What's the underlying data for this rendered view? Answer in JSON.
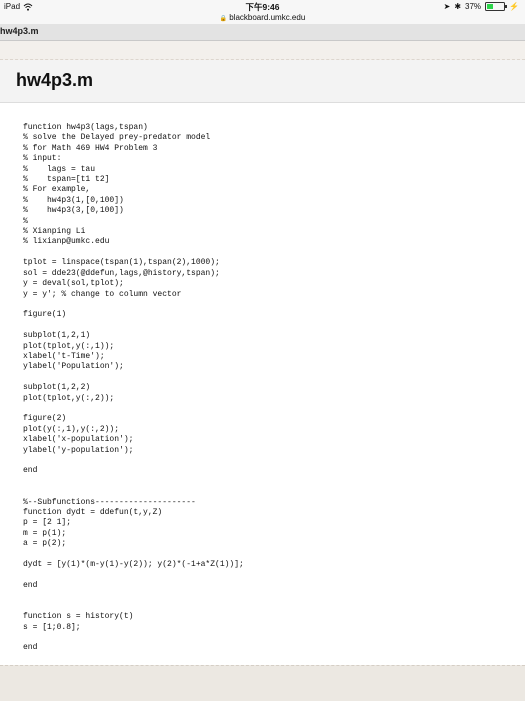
{
  "status_bar": {
    "device": "iPad",
    "time": "下午9:46",
    "battery": "37%",
    "battery_level": 0.37
  },
  "browser": {
    "url": "blackboard.umkc.edu",
    "tab_title": "hw4p3.m"
  },
  "page": {
    "title": "hw4p3.m",
    "code": "function hw4p3(lags,tspan)\n% solve the Delayed prey-predator model\n% for Math 469 HW4 Problem 3\n% input:\n%    lags = tau\n%    tspan=[t1 t2]\n% For example,\n%    hw4p3(1,[0,100])\n%    hw4p3(3,[0,100])\n%\n% Xianping Li\n% lixianp@umkc.edu\n\ntplot = linspace(tspan(1),tspan(2),1000);\nsol = dde23(@ddefun,lags,@history,tspan);\ny = deval(sol,tplot);\ny = y'; % change to column vector\n\nfigure(1)\n\nsubplot(1,2,1)\nplot(tplot,y(:,1));\nxlabel('t-Time');\nylabel('Population');\n\nsubplot(1,2,2)\nplot(tplot,y(:,2));\n\nfigure(2)\nplot(y(:,1),y(:,2));\nxlabel('x-population');\nylabel('y-population');\n\nend\n\n\n%--Subfunctions---------------------\nfunction dydt = ddefun(t,y,Z)\np = [2 1];\nm = p(1);\na = p(2);\n\ndydt = [y(1)*(m-y(1)-y(2)); y(2)*(-1+a*Z(1))];\n\nend\n\n\nfunction s = history(t)\ns = [1;0.8];\n\nend"
  }
}
